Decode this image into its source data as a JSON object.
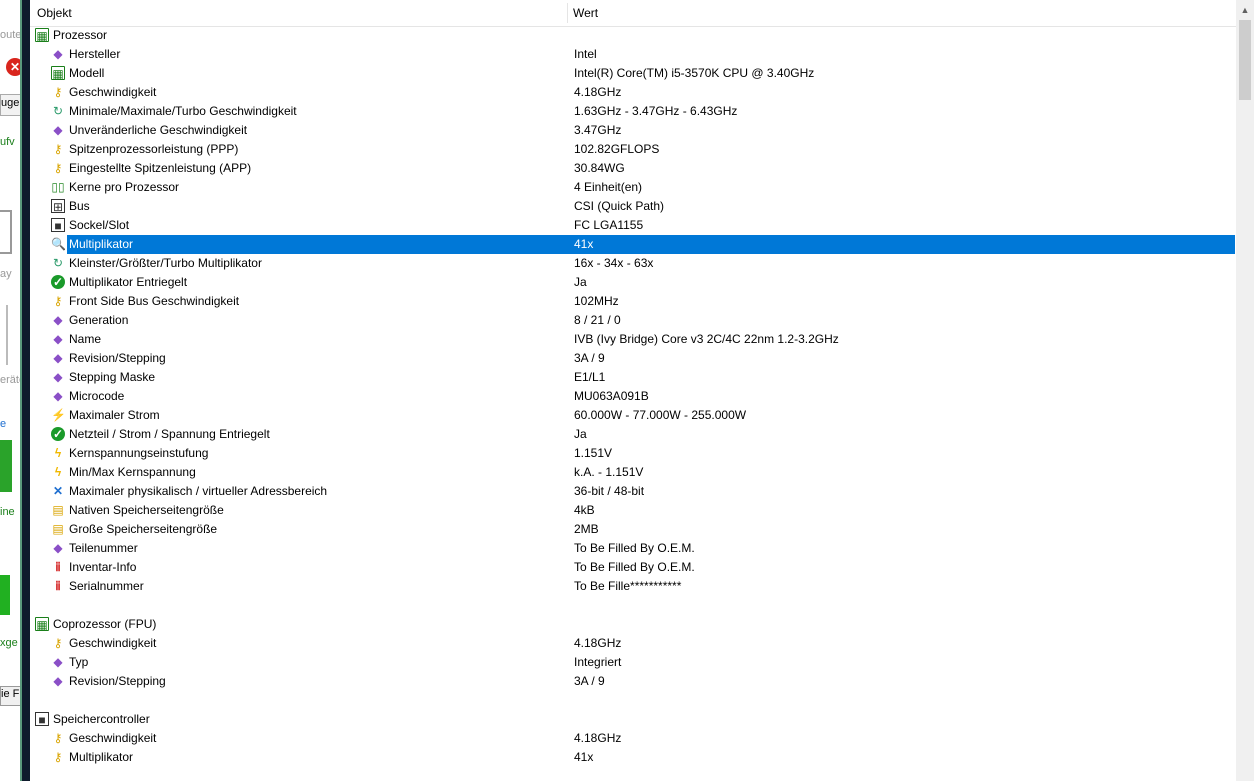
{
  "left_window": {
    "fragments": [
      "oute",
      "uge",
      "ufv",
      "ay",
      "eräte",
      "e",
      "ine",
      "xge",
      "ie F"
    ]
  },
  "columns": {
    "object": "Objekt",
    "value": "Wert"
  },
  "rows": [
    {
      "type": "group",
      "icon": "chip-icon",
      "glyph": "▦",
      "label": "Prozessor",
      "value": ""
    },
    {
      "type": "item",
      "icon": "diamond-icon",
      "glyph": "◆",
      "label": "Hersteller",
      "value": "Intel"
    },
    {
      "type": "item",
      "icon": "chip-icon",
      "glyph": "▦",
      "label": "Modell",
      "value": "Intel(R) Core(TM) i5-3570K CPU @ 3.40GHz"
    },
    {
      "type": "item",
      "icon": "key-icon",
      "glyph": "⚷",
      "label": "Geschwindigkeit",
      "value": "4.18GHz"
    },
    {
      "type": "item",
      "icon": "search-icon",
      "glyph": "↻",
      "label": "Minimale/Maximale/Turbo Geschwindigkeit",
      "value": "1.63GHz - 3.47GHz - 6.43GHz"
    },
    {
      "type": "item",
      "icon": "diamond-icon",
      "glyph": "◆",
      "label": "Unveränderliche Geschwindigkeit",
      "value": "3.47GHz"
    },
    {
      "type": "item",
      "icon": "key-icon",
      "glyph": "⚷",
      "label": "Spitzenprozessorleistung (PPP)",
      "value": "102.82GFLOPS"
    },
    {
      "type": "item",
      "icon": "key-icon",
      "glyph": "⚷",
      "label": "Eingestellte Spitzenleistung (APP)",
      "value": "30.84WG"
    },
    {
      "type": "item",
      "icon": "cores-icon",
      "glyph": "▯▯",
      "label": "Kerne pro Prozessor",
      "value": "4 Einheit(en)"
    },
    {
      "type": "item",
      "icon": "bus-icon",
      "glyph": "⊞",
      "label": "Bus",
      "value": "CSI (Quick Path)"
    },
    {
      "type": "item",
      "icon": "socket-icon",
      "glyph": "■",
      "label": "Sockel/Slot",
      "value": "FC LGA1155"
    },
    {
      "type": "item",
      "icon": "search-icon",
      "glyph": "🔍",
      "label": "Multiplikator",
      "value": "41x",
      "selected": true
    },
    {
      "type": "item",
      "icon": "search-icon",
      "glyph": "↻",
      "label": "Kleinster/Größter/Turbo Multiplikator",
      "value": "16x - 34x - 63x"
    },
    {
      "type": "item",
      "icon": "check-icon",
      "glyph": "✓",
      "label": "Multiplikator Entriegelt",
      "value": "Ja"
    },
    {
      "type": "item",
      "icon": "key-icon",
      "glyph": "⚷",
      "label": "Front Side Bus Geschwindigkeit",
      "value": "102MHz"
    },
    {
      "type": "item",
      "icon": "diamond-icon",
      "glyph": "◆",
      "label": "Generation",
      "value": "8 / 21 / 0"
    },
    {
      "type": "item",
      "icon": "diamond-icon",
      "glyph": "◆",
      "label": "Name",
      "value": "IVB (Ivy Bridge) Core v3 2C/4C 22nm 1.2-3.2GHz"
    },
    {
      "type": "item",
      "icon": "diamond-icon",
      "glyph": "◆",
      "label": "Revision/Stepping",
      "value": "3A / 9"
    },
    {
      "type": "item",
      "icon": "diamond-icon",
      "glyph": "◆",
      "label": "Stepping Maske",
      "value": "E1/L1"
    },
    {
      "type": "item",
      "icon": "diamond-icon",
      "glyph": "◆",
      "label": "Microcode",
      "value": "MU063A091B"
    },
    {
      "type": "item",
      "icon": "power-icon",
      "glyph": "⚡",
      "label": "Maximaler Strom",
      "value": "60.000W - 77.000W - 255.000W"
    },
    {
      "type": "item",
      "icon": "check-icon",
      "glyph": "✓",
      "label": "Netzteil / Strom / Spannung Entriegelt",
      "value": "Ja"
    },
    {
      "type": "item",
      "icon": "bolt-icon",
      "glyph": "ϟ",
      "label": "Kernspannungseinstufung",
      "value": "1.151V"
    },
    {
      "type": "item",
      "icon": "bolt-icon",
      "glyph": "ϟ",
      "label": "Min/Max Kernspannung",
      "value": "k.A. - 1.151V"
    },
    {
      "type": "item",
      "icon": "cross-arrows-icon",
      "glyph": "✕",
      "label": "Maximaler physikalisch / virtueller Adressbereich",
      "value": "36-bit / 48-bit"
    },
    {
      "type": "item",
      "icon": "memory-icon",
      "glyph": "▤",
      "label": "Nativen Speicherseitengröße",
      "value": "4kB"
    },
    {
      "type": "item",
      "icon": "memory-icon",
      "glyph": "▤",
      "label": "Große Speicherseitengröße",
      "value": "2MB"
    },
    {
      "type": "item",
      "icon": "diamond-icon",
      "glyph": "◆",
      "label": "Teilenummer",
      "value": "To Be Filled By O.E.M."
    },
    {
      "type": "item",
      "icon": "tag-icon",
      "glyph": "ⅱ",
      "label": "Inventar-Info",
      "value": "To Be Filled By O.E.M."
    },
    {
      "type": "item",
      "icon": "tag-icon",
      "glyph": "ⅱ",
      "label": "Serialnummer",
      "value": "To Be Fille***********"
    },
    {
      "type": "spacer"
    },
    {
      "type": "group",
      "icon": "chip-icon",
      "glyph": "▦",
      "label": "Coprozessor (FPU)",
      "value": ""
    },
    {
      "type": "item",
      "icon": "key-icon",
      "glyph": "⚷",
      "label": "Geschwindigkeit",
      "value": "4.18GHz"
    },
    {
      "type": "item",
      "icon": "diamond-icon",
      "glyph": "◆",
      "label": "Typ",
      "value": "Integriert"
    },
    {
      "type": "item",
      "icon": "diamond-icon",
      "glyph": "◆",
      "label": "Revision/Stepping",
      "value": "3A / 9"
    },
    {
      "type": "spacer"
    },
    {
      "type": "group",
      "icon": "socket-icon",
      "glyph": "■",
      "label": "Speichercontroller",
      "value": ""
    },
    {
      "type": "item",
      "icon": "key-icon",
      "glyph": "⚷",
      "label": "Geschwindigkeit",
      "value": "4.18GHz"
    },
    {
      "type": "item",
      "icon": "key-icon",
      "glyph": "⚷",
      "label": "Multiplikator",
      "value": "41x"
    }
  ]
}
